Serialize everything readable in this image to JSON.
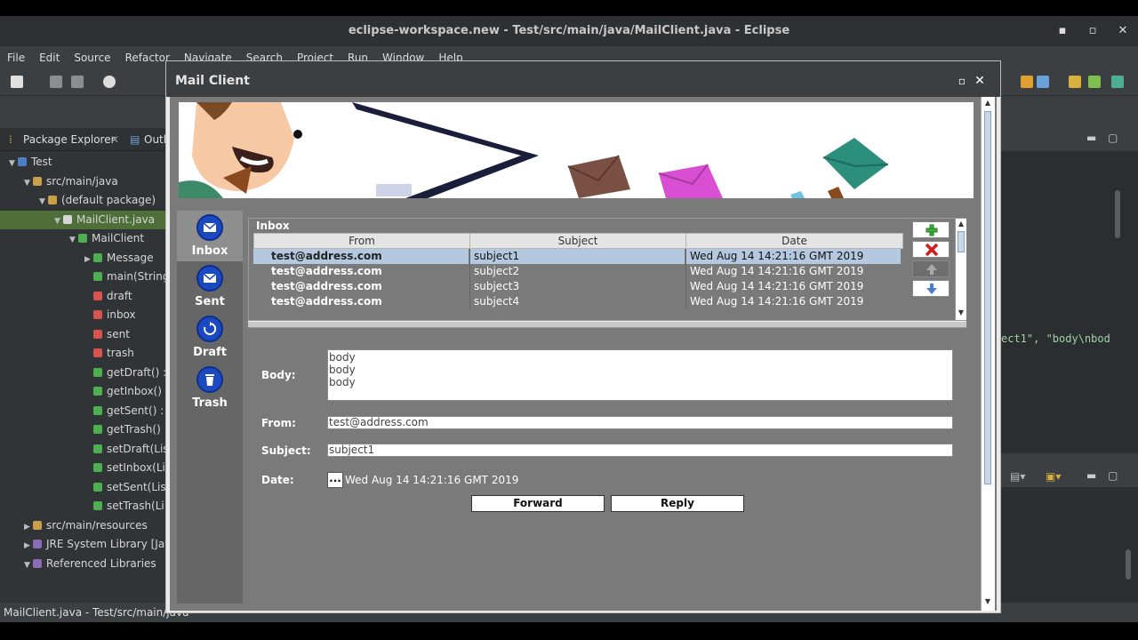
{
  "eclipse": {
    "title": "eclipse-workspace.new - Test/src/main/java/MailClient.java - Eclipse",
    "menu": [
      "File",
      "Edit",
      "Source",
      "Refactor",
      "Navigate",
      "Search",
      "Project",
      "Run",
      "Window",
      "Help"
    ],
    "panel_tabs": {
      "package_explorer": "Package Explorer",
      "outline": "Outl"
    },
    "tree": [
      {
        "label": "Test",
        "twisty": "▼",
        "depth": 0,
        "color": "#4d7fc4"
      },
      {
        "label": "src/main/java",
        "twisty": "▼",
        "depth": 1,
        "color": "#c9a04a"
      },
      {
        "label": "(default package)",
        "twisty": "▼",
        "depth": 2,
        "color": "#c9a04a"
      },
      {
        "label": "MailClient.java",
        "twisty": "▼",
        "depth": 3,
        "color": "#d6d6d6",
        "selected": true
      },
      {
        "label": "MailClient",
        "twisty": "▼",
        "depth": 4,
        "color": "#4caf50"
      },
      {
        "label": "Message",
        "twisty": "▶",
        "depth": 5,
        "color": "#4caf50"
      },
      {
        "label": "main(String",
        "twisty": "",
        "depth": 5,
        "color": "#4caf50"
      },
      {
        "label": "draft",
        "twisty": "",
        "depth": 5,
        "color": "#d9534f"
      },
      {
        "label": "inbox",
        "twisty": "",
        "depth": 5,
        "color": "#d9534f"
      },
      {
        "label": "sent",
        "twisty": "",
        "depth": 5,
        "color": "#d9534f"
      },
      {
        "label": "trash",
        "twisty": "",
        "depth": 5,
        "color": "#d9534f"
      },
      {
        "label": "getDraft() :",
        "twisty": "",
        "depth": 5,
        "color": "#4caf50"
      },
      {
        "label": "getInbox()",
        "twisty": "",
        "depth": 5,
        "color": "#4caf50"
      },
      {
        "label": "getSent() :",
        "twisty": "",
        "depth": 5,
        "color": "#4caf50"
      },
      {
        "label": "getTrash()",
        "twisty": "",
        "depth": 5,
        "color": "#4caf50"
      },
      {
        "label": "setDraft(Lis",
        "twisty": "",
        "depth": 5,
        "color": "#4caf50"
      },
      {
        "label": "setInbox(Li",
        "twisty": "",
        "depth": 5,
        "color": "#4caf50"
      },
      {
        "label": "setSent(Lis",
        "twisty": "",
        "depth": 5,
        "color": "#4caf50"
      },
      {
        "label": "setTrash(Li",
        "twisty": "",
        "depth": 5,
        "color": "#4caf50"
      },
      {
        "label": "src/main/resources",
        "twisty": "▶",
        "depth": 1,
        "color": "#c9a04a"
      },
      {
        "label": "JRE System Library [Java",
        "twisty": "▶",
        "depth": 1,
        "color": "#8a6bb8"
      },
      {
        "label": "Referenced Libraries",
        "twisty": "▼",
        "depth": 1,
        "color": "#8a6bb8"
      }
    ],
    "status": "MailClient.java - Test/src/main/java",
    "code_fragment": "ect1\", \"body\\nbod"
  },
  "mail": {
    "window_title": "Mail Client",
    "nav": [
      {
        "label": "Inbox",
        "icon": "envelope-icon",
        "active": true
      },
      {
        "label": "Sent",
        "icon": "envelope-icon",
        "active": false
      },
      {
        "label": "Draft",
        "icon": "refresh-icon",
        "active": false
      },
      {
        "label": "Trash",
        "icon": "trash-icon",
        "active": false
      }
    ],
    "inbox": {
      "title": "Inbox",
      "columns": {
        "from": "From",
        "subject": "Subject",
        "date": "Date"
      },
      "rows": [
        {
          "from": "test@address.com",
          "subject": "subject1",
          "date": "Wed Aug 14 14:21:16 GMT 2019"
        },
        {
          "from": "test@address.com",
          "subject": "subject2",
          "date": "Wed Aug 14 14:21:16 GMT 2019"
        },
        {
          "from": "test@address.com",
          "subject": "subject3",
          "date": "Wed Aug 14 14:21:16 GMT 2019"
        },
        {
          "from": "test@address.com",
          "subject": "subject4",
          "date": "Wed Aug 14 14:21:16 GMT 2019"
        }
      ],
      "selected_row": 0,
      "buttons": [
        "add-icon",
        "delete-icon",
        "arrow-up-icon",
        "arrow-down-icon"
      ]
    },
    "detail": {
      "body_label": "Body:",
      "body_lines": [
        "body",
        "body",
        "body"
      ],
      "from_label": "From:",
      "from_value": "test@address.com",
      "subject_label": "Subject:",
      "subject_value": "subject1",
      "date_label": "Date:",
      "date_button": "...",
      "date_value": "Wed Aug 14 14:21:16 GMT 2019",
      "forward_label": "Forward",
      "reply_label": "Reply"
    }
  }
}
